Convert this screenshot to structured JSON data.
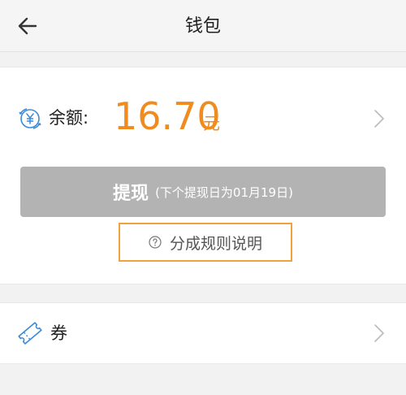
{
  "header": {
    "title": "钱包",
    "back_icon": "arrow-left-icon"
  },
  "balance": {
    "label": "余额:",
    "amount": "16.70",
    "unit": "元",
    "icon": "yen-coin-icon",
    "accent_color": "#f08c1e"
  },
  "withdraw": {
    "label": "提现",
    "note": "(下个提现日为01月19日)",
    "state": "disabled",
    "color": "#b3b3b3"
  },
  "rules_link": {
    "label": "分成规则说明",
    "icon": "question-circle-icon",
    "highlight_color": "#f0a23c"
  },
  "coupon": {
    "label": "券",
    "icon": "ticket-icon"
  }
}
